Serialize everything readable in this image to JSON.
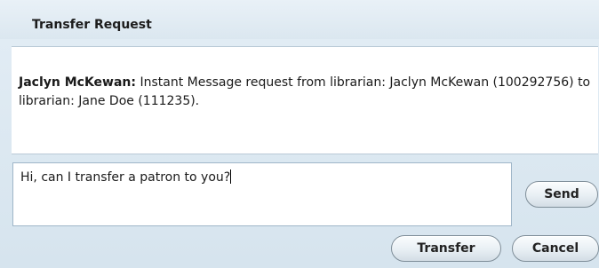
{
  "dialog": {
    "title": "Transfer Request"
  },
  "message": {
    "sender": "Jaclyn McKewan:",
    "text": " Instant Message request from librarian: Jaclyn McKewan (100292756) to librarian: Jane Doe (111235)."
  },
  "compose": {
    "value": "Hi, can I transfer a patron to you?"
  },
  "buttons": {
    "send": "Send",
    "transfer": "Transfer",
    "cancel": "Cancel"
  }
}
